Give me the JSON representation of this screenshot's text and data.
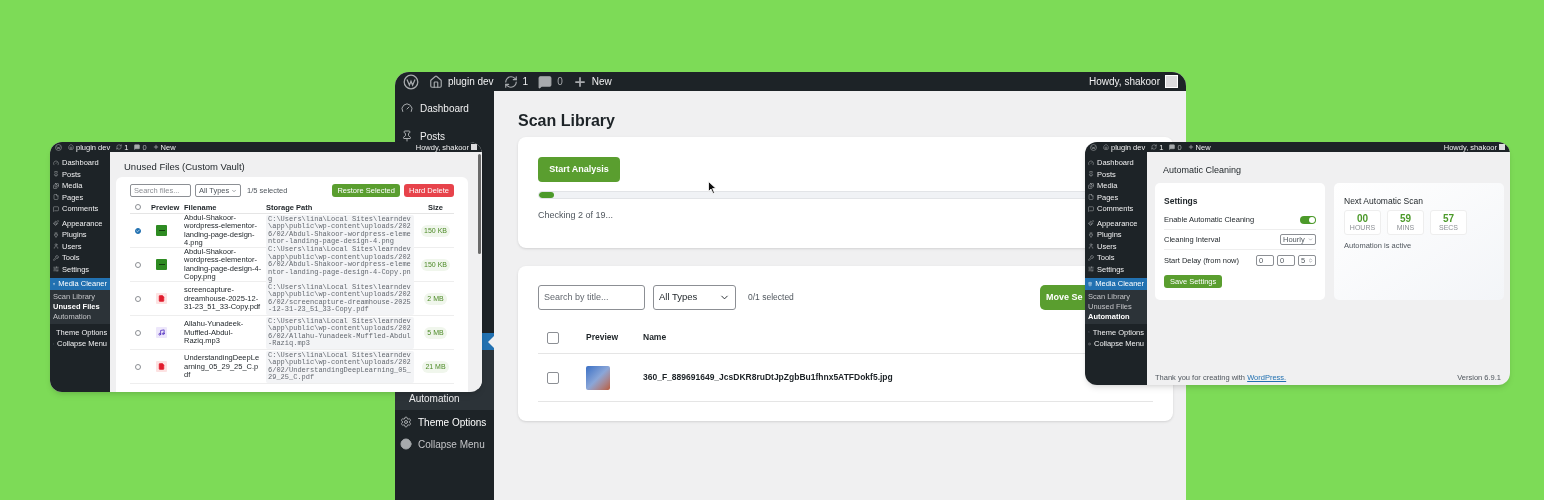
{
  "scan_window": {
    "admin_bar": {
      "site": "plugin dev",
      "updates": "1",
      "comments": "0",
      "new": "New",
      "greeting": "Howdy, shakoor"
    },
    "menu_top": [
      {
        "label": "Dashboard"
      },
      {
        "label": "Posts"
      }
    ],
    "submenu": [
      {
        "label": "Automation",
        "selected": false
      }
    ],
    "menu_bottom": [
      {
        "label": "Theme Options"
      },
      {
        "label": "Collapse Menu"
      }
    ],
    "title": "Scan Library",
    "analysis": {
      "button": "Start Analysis",
      "level": 0.025,
      "status": "Checking 2 of 19..."
    },
    "results": {
      "search_placeholder": "Search by title...",
      "type_filter": "All Types",
      "selection": "0/1 selected",
      "move_button": "Move Se",
      "header_checked": false,
      "columns": [
        "Preview",
        "Name"
      ],
      "rows": [
        {
          "checked": false,
          "name": "360_F_889691649_JcsDKR8ruDtJpZgbBu1fhnx5ATFDokf5.jpg"
        }
      ]
    }
  },
  "unused_files_window": {
    "admin_bar": {
      "site": "plugin dev",
      "updates": "1",
      "comments": "0",
      "new": "New",
      "greeting": "Howdy, shakoor"
    },
    "menu": [
      {
        "label": "Dashboard",
        "selected": false
      },
      {
        "label": "Posts",
        "selected": false
      },
      {
        "label": "Media",
        "selected": false
      },
      {
        "label": "Pages",
        "selected": false
      },
      {
        "label": "Comments",
        "selected": false
      },
      {
        "label": "Appearance",
        "selected": false
      },
      {
        "label": "Plugins",
        "selected": false
      },
      {
        "label": "Users",
        "selected": false
      },
      {
        "label": "Tools",
        "selected": false
      },
      {
        "label": "Settings",
        "selected": false
      },
      {
        "label": "Media Cleaner",
        "selected": true,
        "submenu": [
          {
            "label": "Scan Library",
            "selected": false
          },
          {
            "label": "Unused Files",
            "selected": true
          },
          {
            "label": "Automation",
            "selected": false
          }
        ]
      },
      {
        "label": "Theme Options",
        "selected": false
      },
      {
        "label": "Collapse Menu",
        "selected": false
      }
    ],
    "title": "Unused Files (Custom Vault)",
    "search_placeholder": "Search files...",
    "type_filter": "All Types",
    "selection": "1/5 selected",
    "buttons": [
      {
        "label": "Restore Selected",
        "kind": "restore"
      },
      {
        "label": "Hard Delete",
        "kind": "delete"
      }
    ],
    "header_checked": false,
    "columns": [
      "Preview",
      "Filename",
      "Storage Path",
      "Size"
    ],
    "rows": [
      {
        "kind": "image",
        "checked": true,
        "filename": "Abdul-Shakoor-wordpress-elementor-landing-page-design-4.png",
        "path": "C:\\Users\\lina\\Local Sites\\learndev\\app\\public\\wp-content\\uploads/2026/02/Abdul-Shakoor-wordpress-elementor-landing-page-design-4.png",
        "size": "150 KB"
      },
      {
        "kind": "image",
        "checked": false,
        "filename": "Abdul-Shakoor-wordpress-elementor-landing-page-design-4-Copy.png",
        "path": "C:\\Users\\lina\\Local Sites\\learndev\\app\\public\\wp-content\\uploads/2026/02/Abdul-Shakoor-wordpress-elementor-landing-page-design-4-Copy.png",
        "size": "150 KB"
      },
      {
        "kind": "pdf",
        "checked": false,
        "filename": "screencapture-dreamhouse-2025-12-31-23_51_33-Copy.pdf",
        "path": "C:\\Users\\lina\\Local Sites\\learndev\\app\\public\\wp-content\\uploads/2026/02/screencapture-dreamhouse-2025-12-31-23_51_33-Copy.pdf",
        "size": "2 MB"
      },
      {
        "kind": "audio",
        "checked": false,
        "filename": "Allahu-Yunadeek-Muffled-Abdul-Raziq.mp3",
        "path": "C:\\Users\\lina\\Local Sites\\learndev\\app\\public\\wp-content\\uploads/2026/02/Allahu-Yunadeek-Muffled-Abdul-Raziq.mp3",
        "size": "5 MB"
      },
      {
        "kind": "pdf",
        "checked": false,
        "filename": "UnderstandingDeepLearning_05_29_25_C.pdf",
        "path": "C:\\Users\\lina\\Local Sites\\learndev\\app\\public\\wp-content\\uploads/2026/02/UnderstandingDeepLearning_05_29_25_C.pdf",
        "size": "21 MB"
      }
    ]
  },
  "automation_window": {
    "admin_bar": {
      "site": "plugin dev",
      "updates": "1",
      "comments": "0",
      "new": "New",
      "greeting": "Howdy, shakoor"
    },
    "menu": [
      {
        "label": "Dashboard",
        "selected": false
      },
      {
        "label": "Posts",
        "selected": false
      },
      {
        "label": "Media",
        "selected": false
      },
      {
        "label": "Pages",
        "selected": false
      },
      {
        "label": "Comments",
        "selected": false
      },
      {
        "label": "Appearance",
        "selected": false
      },
      {
        "label": "Plugins",
        "selected": false
      },
      {
        "label": "Users",
        "selected": false
      },
      {
        "label": "Tools",
        "selected": false
      },
      {
        "label": "Settings",
        "selected": false
      },
      {
        "label": "Media Cleaner",
        "selected": true,
        "submenu": [
          {
            "label": "Scan Library",
            "selected": false
          },
          {
            "label": "Unused Files",
            "selected": false
          },
          {
            "label": "Automation",
            "selected": true
          }
        ]
      },
      {
        "label": "Theme Options",
        "selected": false
      },
      {
        "label": "Collapse Menu",
        "selected": false
      }
    ],
    "title": "Automatic Cleaning",
    "settings": {
      "title": "Settings",
      "rows": [
        {
          "kind": "toggle",
          "label": "Enable Automatic Cleaning",
          "on": true
        },
        {
          "kind": "select",
          "label": "Cleaning Interval",
          "value": "Hourly"
        },
        {
          "kind": "delay",
          "label": "Start Delay (from now)",
          "values": [
            "0",
            "0",
            "5"
          ]
        }
      ],
      "save_button": "Save Settings"
    },
    "next_scan": {
      "title": "Next Automatic Scan",
      "units": [
        {
          "value": "00",
          "label": "HOURS"
        },
        {
          "value": "59",
          "label": "MINS"
        },
        {
          "value": "57",
          "label": "SECS"
        }
      ],
      "status": "Automation is active"
    },
    "footer": {
      "text": "Thank you for creating with",
      "link": "WordPress.",
      "version": "Version 6.9.1"
    }
  }
}
